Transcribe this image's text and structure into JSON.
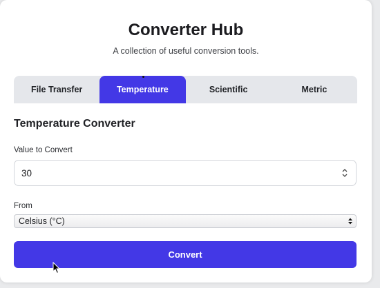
{
  "header": {
    "title": "Converter Hub",
    "subtitle": "A collection of useful conversion tools."
  },
  "tabs": [
    {
      "label": "File Transfer",
      "active": false
    },
    {
      "label": "Temperature",
      "active": true
    },
    {
      "label": "Scientific",
      "active": false
    },
    {
      "label": "Metric",
      "active": false
    }
  ],
  "form": {
    "section_title": "Temperature Converter",
    "value_label": "Value to Convert",
    "value": "30",
    "from_label": "From",
    "from_selected": "Celsius (°C)",
    "convert_label": "Convert"
  },
  "colors": {
    "accent": "#4338e6",
    "tab_bg": "#e5e7eb"
  },
  "icons": {
    "stepper": "up-down-stepper-icon",
    "select": "select-arrows-icon",
    "cursor": "mouse-pointer-icon"
  }
}
